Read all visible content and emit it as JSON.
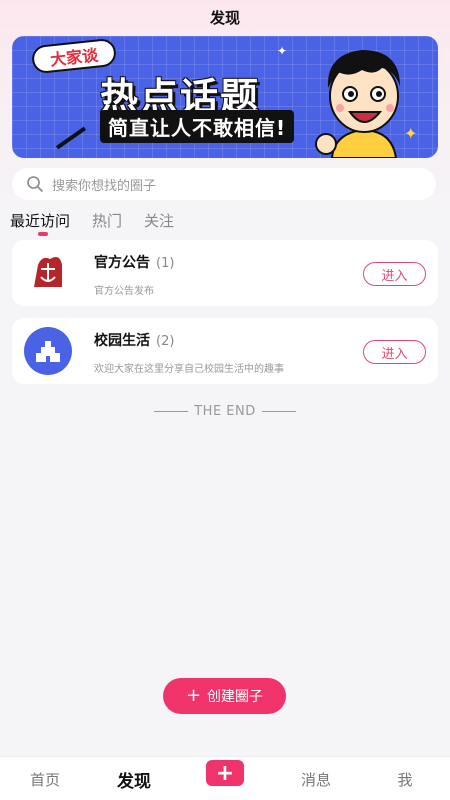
{
  "header": {
    "title": "发现"
  },
  "banner": {
    "tag": "大家谈",
    "headline": "热点话题",
    "subline": "简直让人不敢相信!",
    "illustration": "cartoon-boy-illustration"
  },
  "search": {
    "placeholder": "搜索你想找的圈子",
    "icon": "search-icon"
  },
  "tabs": [
    {
      "label": "最近访问",
      "active": true
    },
    {
      "label": "热门",
      "active": false
    },
    {
      "label": "关注",
      "active": false
    }
  ],
  "circles": [
    {
      "name": "官方公告",
      "count": "(1)",
      "desc": "官方公告发布",
      "button": "进入",
      "avatar": "school-seal-icon",
      "avatar_color": "#b5262a"
    },
    {
      "name": "校园生活",
      "count": "(2)",
      "desc": "欢迎大家在这里分享自己校园生活中的趣事",
      "button": "进入",
      "avatar": "campus-building-icon",
      "avatar_color": "#4a63e6"
    }
  ],
  "end_text": "THE END",
  "create_button": {
    "label": "创建圈子",
    "icon": "plus-icon"
  },
  "bottom_nav": {
    "items": [
      "首页",
      "发现",
      "消息",
      "我"
    ],
    "active": "发现",
    "center_icon": "plus-icon"
  },
  "colors": {
    "accent": "#f0336b",
    "banner": "#4a63e6",
    "outline": "#e04a72"
  }
}
